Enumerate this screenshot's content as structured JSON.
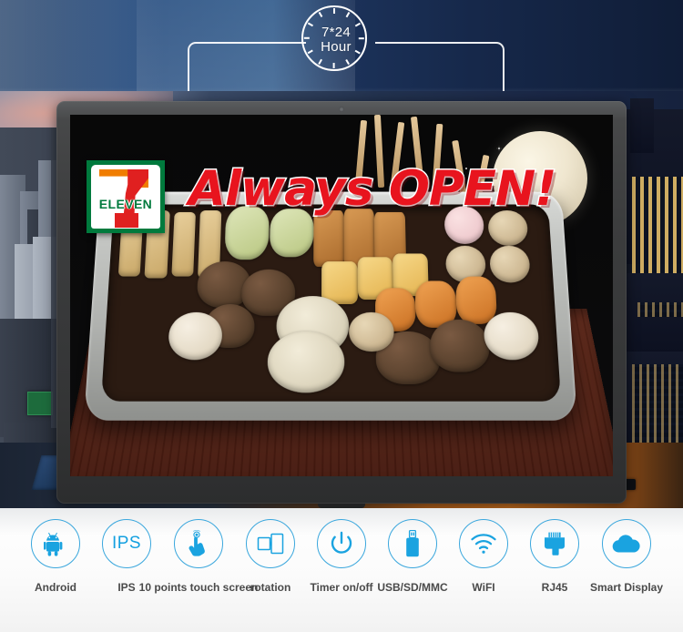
{
  "hero": {
    "clock": {
      "line1": "7*24",
      "line2": "Hour",
      "icon": "clock-icon"
    },
    "screen": {
      "brand_logo": {
        "name": "seven-eleven-logo",
        "wordmark": "ELEVEN",
        "numeral": "7",
        "colors": {
          "green": "#007a3d",
          "red": "#e02020",
          "orange": "#f07d00"
        }
      },
      "headline": "Always OPEN!",
      "headline_color": "#e8141e",
      "headline_outline": "#ffffff",
      "content_description": "oden hot food tray on wooden counter"
    }
  },
  "features": [
    {
      "label": "Android",
      "icon": "android-robot-icon",
      "text_in_icon": ""
    },
    {
      "label": "IPS",
      "icon": "ips-text-icon",
      "text_in_icon": "IPS"
    },
    {
      "label": "10 points touch screen",
      "icon": "touch-hand-icon",
      "text_in_icon": ""
    },
    {
      "label": "rotation",
      "icon": "screen-rotation-icon",
      "text_in_icon": ""
    },
    {
      "label": "Timer on/off",
      "icon": "power-timer-icon",
      "text_in_icon": ""
    },
    {
      "label": "USB/SD/MMC",
      "icon": "usb-drive-icon",
      "text_in_icon": ""
    },
    {
      "label": "WiFI",
      "icon": "wifi-icon",
      "text_in_icon": ""
    },
    {
      "label": "RJ45",
      "icon": "rj45-ethernet-icon",
      "text_in_icon": ""
    },
    {
      "label": "Smart Display",
      "icon": "cloud-icon",
      "text_in_icon": ""
    }
  ],
  "theme": {
    "accent_blue": "#3aa7dd",
    "icon_fill": "#1aa3e0",
    "label_color": "#4a4a4a",
    "bar_background": "#ffffff",
    "bezel_color": "#3a3b3c"
  }
}
